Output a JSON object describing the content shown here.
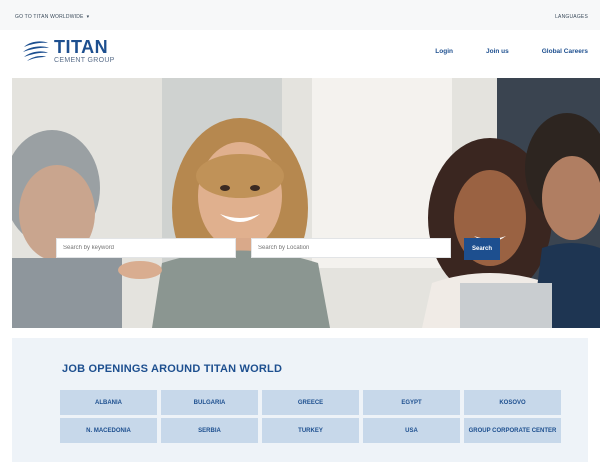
{
  "topbar": {
    "worldwide_label": "GO TO TITAN WORLDWIDE",
    "languages_label": "LANGUAGES"
  },
  "brand": {
    "name": "TITAN",
    "subtitle": "CEMENT GROUP",
    "color": "#1d4f8f"
  },
  "nav": {
    "items": [
      "Login",
      "Join us",
      "Global Careers"
    ]
  },
  "search": {
    "keyword_placeholder": "Search by keyword",
    "location_placeholder": "Search by Location",
    "button_label": "Search"
  },
  "jobs": {
    "title": "JOB OPENINGS AROUND TITAN WORLD",
    "countries": [
      "ALBANIA",
      "BULGARIA",
      "GREECE",
      "EGYPT",
      "KOSOVO",
      "N. MACEDONIA",
      "SERBIA",
      "TURKEY",
      "USA",
      "GROUP CORPORATE CENTER"
    ]
  }
}
